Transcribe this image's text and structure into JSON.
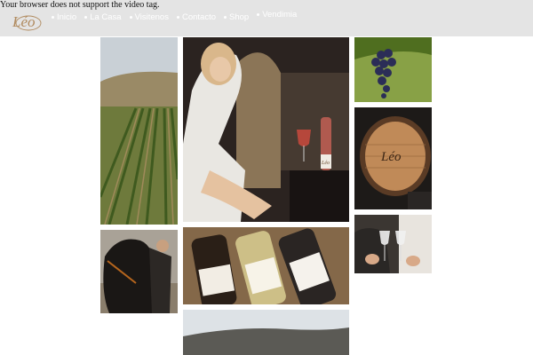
{
  "video_fallback": "Your browser does not support the video tag.",
  "logo": {
    "text": "Léo"
  },
  "nav": {
    "items": [
      {
        "label": "Inicio"
      },
      {
        "label": "La Casa"
      },
      {
        "label": "Visitenos"
      },
      {
        "label": "Contacto"
      },
      {
        "label": "Shop"
      },
      {
        "label": "Vendimia"
      }
    ]
  },
  "gallery": {
    "labels": {
      "bottle_brand": "Léo",
      "barrel_brand": "Léo"
    }
  },
  "colors": {
    "header_bg": "#e4e4e4",
    "nav_text": "#ffffff",
    "logo": "#b08a5e"
  }
}
